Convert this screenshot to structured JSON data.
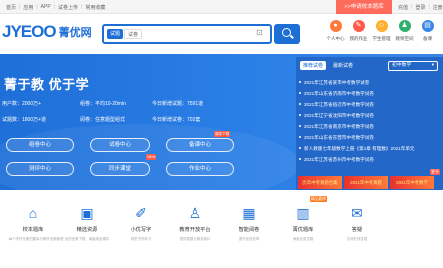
{
  "topbar": {
    "links": [
      "首页",
      "应用",
      "APP",
      "试卷上传",
      "常用收藏"
    ],
    "apply_banner": ">>申请校本题库",
    "right_links": [
      "充值",
      "登录",
      "注册"
    ]
  },
  "logo": {
    "brand": "JYEOO",
    "name": "菁优网"
  },
  "search": {
    "tab_question": "试题",
    "tab_paper": "试卷",
    "placeholder": ""
  },
  "header_nav": [
    {
      "label": "个人中心",
      "icon": "user-icon",
      "color": "#ff7a3a"
    },
    {
      "label": "我的作业",
      "icon": "homework-icon",
      "color": "#ff5a4a"
    },
    {
      "label": "学生管理",
      "icon": "students-icon",
      "color": "#ffb02e"
    },
    {
      "label": "教师空间",
      "icon": "teacher-icon",
      "color": "#2fb06c"
    },
    {
      "label": "备课",
      "icon": "lesson-icon",
      "color": "#3a86e6"
    }
  ],
  "banner": {
    "slogan": "菁于教 优于学",
    "stats": [
      {
        "text": "用户数：2000万+"
      },
      {
        "text": "组卷：平均10-20min"
      },
      {
        "text": "今日新增试题：7591道"
      },
      {
        "text": "试题数：1800万+道"
      },
      {
        "text": "阅卷：任意题型组式"
      },
      {
        "text": "今日新增试卷：702套"
      }
    ],
    "buttons": [
      "组卷中心",
      "试卷中心",
      "备课中心",
      "测评中心",
      "同步课堂",
      "作业中心"
    ],
    "badges": [
      "课件下载",
      "NEW"
    ]
  },
  "news_panel": {
    "tab_active": "推荐试卷",
    "tab_other": "最新试卷",
    "grade_select": "初中数学",
    "items": [
      "2021年江苏省某市中考数学试卷",
      "2021年山东省济南市中考数学试卷",
      "2021年江苏省宿迁市中考数学试卷",
      "2021年辽宁省沈阳市中考数学试卷",
      "2021年江苏省南京市中考数学试卷",
      "2021年山东省东营市中考数学试卷",
      "新人教版七年级数学上册《第1章 有理数》2021年单元",
      "2021年江苏省苏州市中考数学试卷"
    ],
    "ads": [
      "历年中考真题合集",
      "2021年中考真题",
      "2021年中考数学"
    ],
    "more": "更多"
  },
  "features": [
    {
      "title": "校本题库",
      "desc": "每个学校专属的题库与教学资源管理",
      "icon": "building-icon"
    },
    {
      "title": "精选资源",
      "desc": "优质资源下载，海量精品课件",
      "icon": "book-icon"
    },
    {
      "title": "小优写字",
      "desc": "规范书写练习",
      "icon": "cap-icon"
    },
    {
      "title": "教育开放平台",
      "desc": "提供数据与服务接口",
      "icon": "graduation-icon"
    },
    {
      "title": "智能阅卷",
      "desc": "提升批改效率",
      "icon": "scan-icon"
    },
    {
      "title": "菁优题库",
      "desc": "海量优质试题",
      "icon": "library-icon",
      "badge": "精品题库"
    },
    {
      "title": "答疑",
      "desc": "名师在线答疑",
      "icon": "chat-icon"
    }
  ]
}
